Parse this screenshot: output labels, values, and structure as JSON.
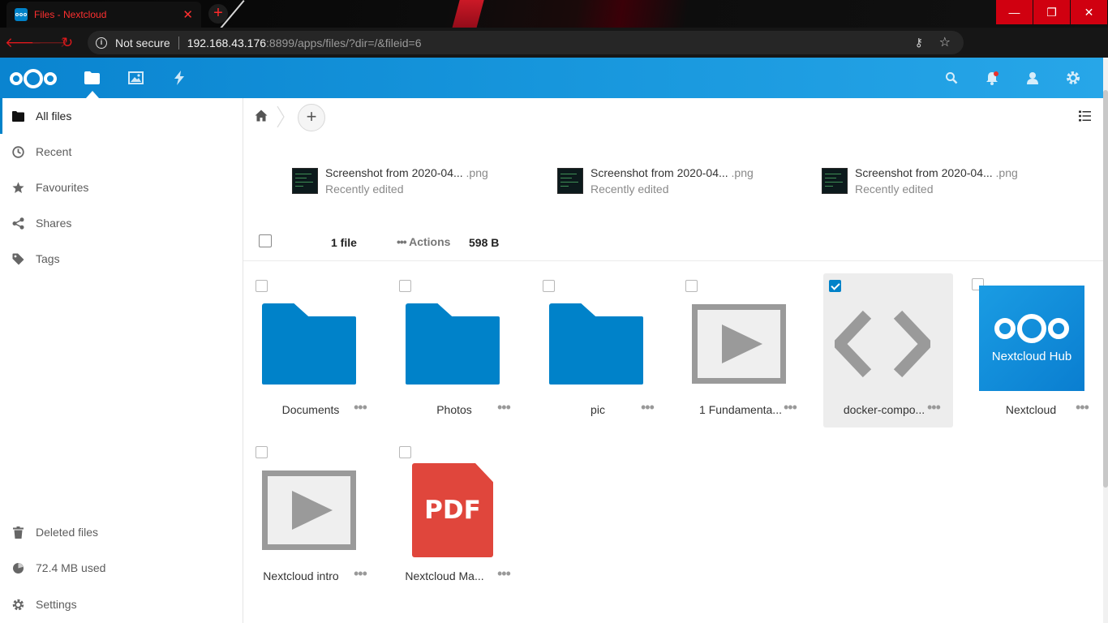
{
  "browser": {
    "tab_title": "Files - Nextcloud",
    "security_label": "Not secure",
    "url_host": "192.168.43.176",
    "url_path": ":8899/apps/files/?dir=/&fileid=6"
  },
  "sidebar": {
    "items": [
      {
        "label": "All files",
        "icon": "folder-icon"
      },
      {
        "label": "Recent",
        "icon": "clock-icon"
      },
      {
        "label": "Favourites",
        "icon": "star-icon"
      },
      {
        "label": "Shares",
        "icon": "share-icon"
      },
      {
        "label": "Tags",
        "icon": "tag-icon"
      }
    ],
    "footer": [
      {
        "label": "Deleted files",
        "icon": "trash-icon"
      },
      {
        "label": "72.4 MB used",
        "icon": "pie-icon"
      },
      {
        "label": "Settings",
        "icon": "gear-icon"
      }
    ]
  },
  "recent_files": [
    {
      "name": "Screenshot from 2020-04...",
      "ext": " .png",
      "status": "Recently edited"
    },
    {
      "name": "Screenshot from 2020-04...",
      "ext": " .png",
      "status": "Recently edited"
    },
    {
      "name": "Screenshot from 2020-04...",
      "ext": " .png",
      "status": "Recently edited"
    }
  ],
  "selection": {
    "count": "1 file",
    "actions_label": "Actions",
    "size": "598 B"
  },
  "files": [
    {
      "name": "Documents",
      "type": "folder",
      "selected": false
    },
    {
      "name": "Photos",
      "type": "folder",
      "selected": false
    },
    {
      "name": "pic",
      "type": "folder",
      "selected": false
    },
    {
      "name": "1 Fundamenta...",
      "type": "video",
      "selected": false
    },
    {
      "name": "docker-compo...",
      "type": "code",
      "selected": true
    },
    {
      "name": "Nextcloud",
      "type": "image",
      "selected": false,
      "thumb_text": "Nextcloud Hub"
    },
    {
      "name": "Nextcloud intro",
      "type": "video",
      "selected": false
    },
    {
      "name": "Nextcloud Ma...",
      "type": "pdf",
      "selected": false,
      "thumb_text": "PDF"
    }
  ],
  "colors": {
    "brand": "#0082c9",
    "pdf": "#e0463c",
    "browser_accent": "#e2191c"
  }
}
